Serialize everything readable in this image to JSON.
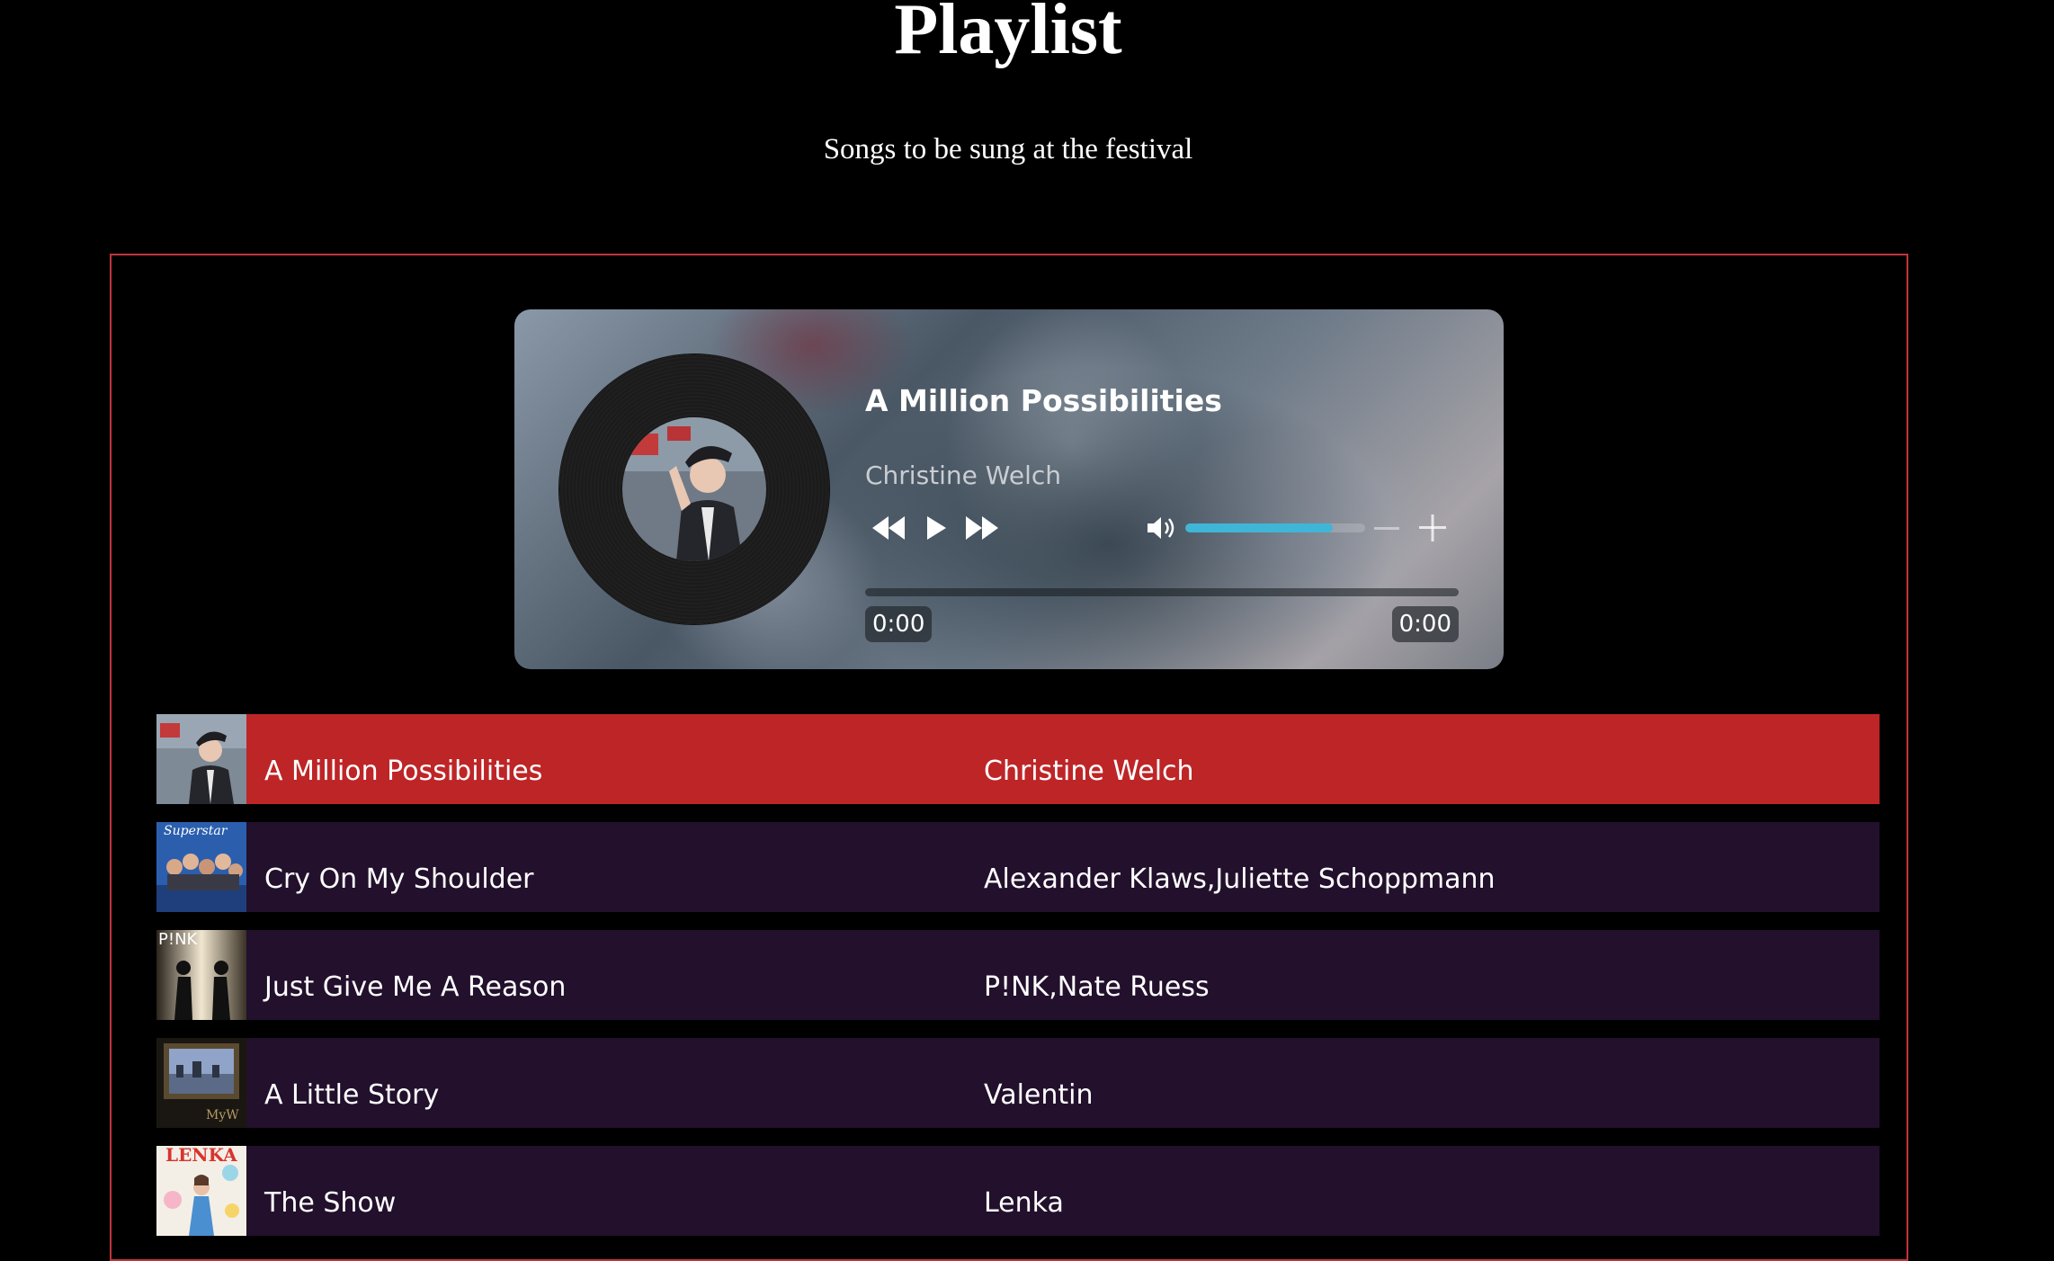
{
  "header": {
    "title": "Playlist",
    "subtitle": "Songs to be sung at the festival"
  },
  "player": {
    "now_playing_title": "A Million Possibilities",
    "now_playing_artist": "Christine Welch",
    "current_time": "0:00",
    "duration": "0:00",
    "volume_level": 0.82,
    "progress": 0,
    "accent_color": "#3fb6d7",
    "controls": [
      "rewind-icon",
      "play-icon",
      "fast-forward-icon",
      "volume-icon",
      "minus-icon",
      "plus-icon"
    ]
  },
  "songs": [
    {
      "title": "A Million Possibilities",
      "artist": "Christine Welch",
      "active": true
    },
    {
      "title": "Cry On My Shoulder",
      "artist": "Alexander Klaws,Juliette Schoppmann",
      "active": false
    },
    {
      "title": "Just Give Me A Reason",
      "artist": "P!NK,Nate Ruess",
      "active": false
    },
    {
      "title": "A Little Story",
      "artist": "Valentin",
      "active": false
    },
    {
      "title": "The Show",
      "artist": "Lenka",
      "active": false
    }
  ],
  "thumbnail_text": {
    "cover_2": "Superstar",
    "cover_3": "P!NK",
    "cover_5": "LENKA"
  },
  "colors": {
    "active_row": "#be2527",
    "row": "#22102c",
    "frame_border": "#c0353a"
  }
}
